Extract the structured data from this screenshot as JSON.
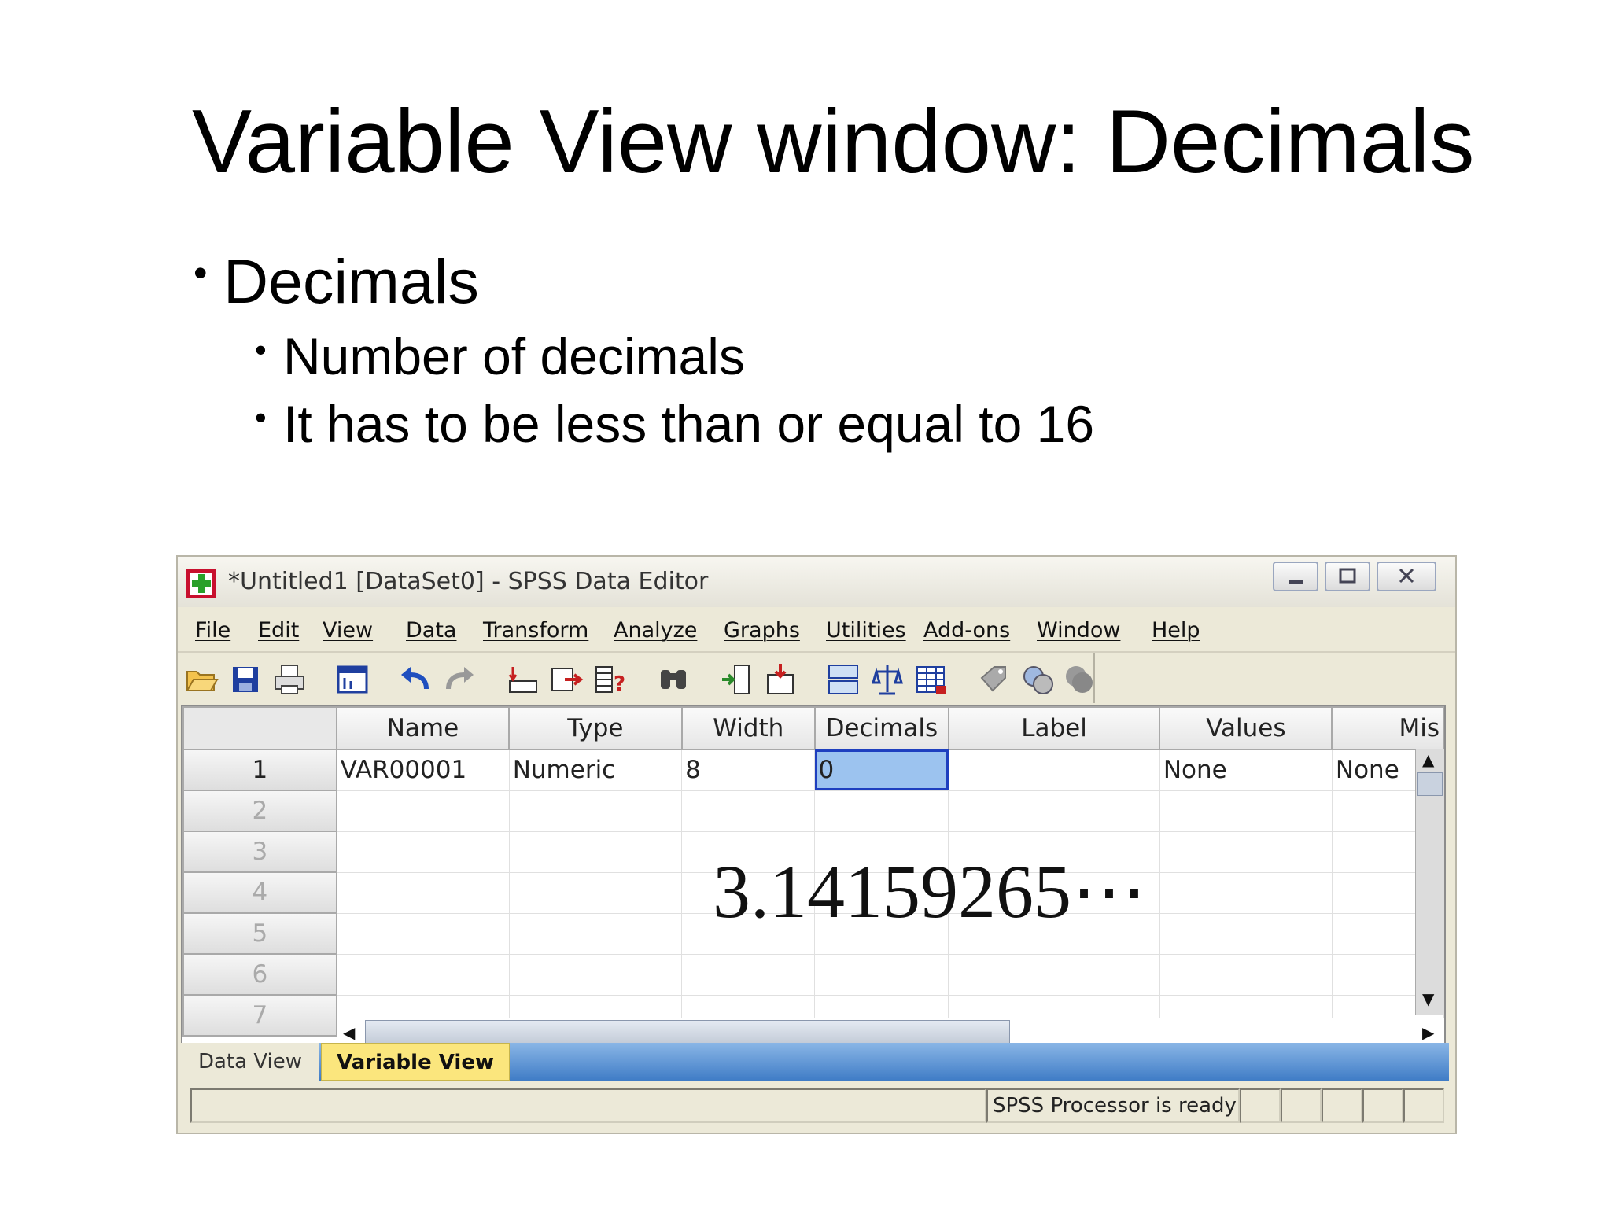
{
  "slide": {
    "title": "Variable View window: Decimals",
    "bullet": "Decimals",
    "bullet_marker": "•",
    "sub_bullets": [
      "Number of decimals",
      "It has to be less than or equal to 16"
    ],
    "overlay_number": "3.14159265⋯"
  },
  "window": {
    "title": "*Untitled1 [DataSet0] - SPSS Data Editor",
    "menu": [
      "File",
      "Edit",
      "View",
      "Data",
      "Transform",
      "Analyze",
      "Graphs",
      "Utilities",
      "Add-ons",
      "Window",
      "Help"
    ],
    "toolbar_icons": [
      "open-folder-icon",
      "save-icon",
      "print-icon",
      "dialog-recall-icon",
      "undo-icon",
      "redo-icon",
      "goto-case-icon",
      "goto-variable-icon",
      "variables-icon",
      "find-icon",
      "insert-cases-icon",
      "insert-variable-icon",
      "split-file-icon",
      "weight-cases-icon",
      "select-cases-icon",
      "value-labels-icon",
      "use-sets-icon",
      "show-all-variables-icon"
    ]
  },
  "grid": {
    "columns": [
      "Name",
      "Type",
      "Width",
      "Decimals",
      "Label",
      "Values",
      "Mis"
    ],
    "row_numbers": [
      "1",
      "2",
      "3",
      "4",
      "5",
      "6",
      "7"
    ],
    "rows": [
      [
        "VAR00001",
        "Numeric",
        "8",
        "0",
        "",
        "None",
        "None"
      ]
    ]
  },
  "tabs": {
    "data_view": "Data View",
    "variable_view": "Variable View"
  },
  "status": {
    "processor": "SPSS  Processor is ready"
  },
  "colors": {
    "selected_cell": "#9cc3ef",
    "selection_border": "#1e3fbf",
    "active_tab": "#fbe67d",
    "tab_bar": "#3f7cc6"
  }
}
